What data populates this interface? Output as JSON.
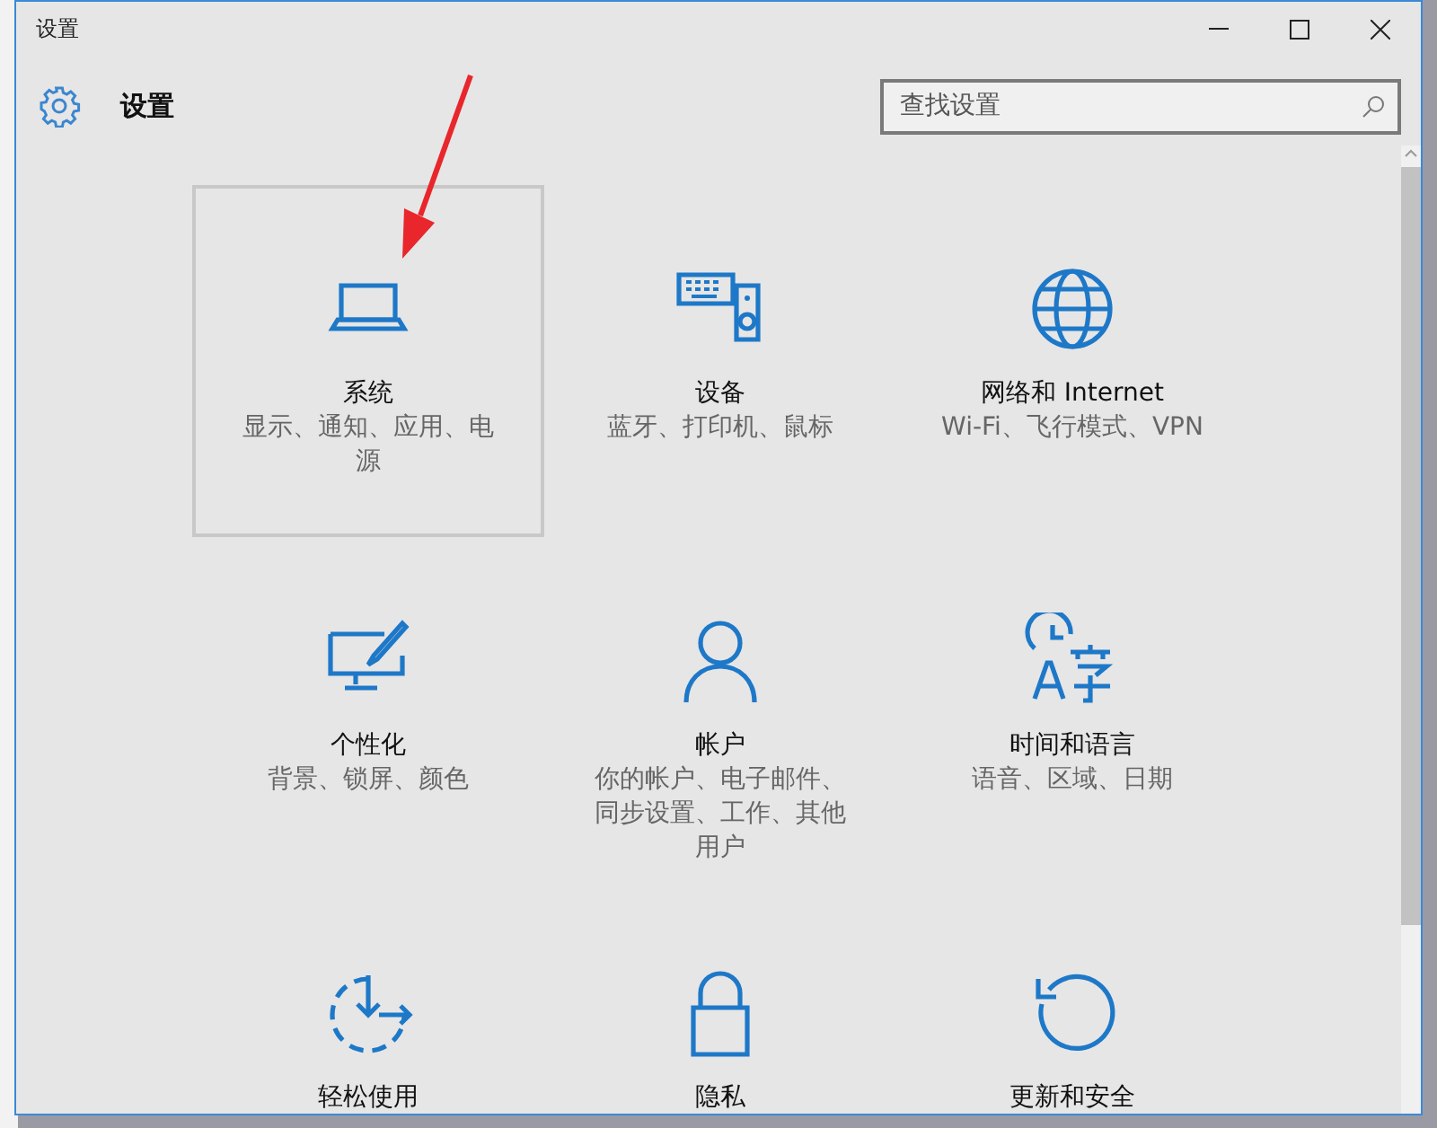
{
  "window": {
    "title": "设置"
  },
  "header": {
    "title": "设置"
  },
  "search": {
    "placeholder": "查找设置"
  },
  "tiles": [
    {
      "title": "系统",
      "subtitle": "显示、通知、应用、电源",
      "selected": true
    },
    {
      "title": "设备",
      "subtitle": "蓝牙、打印机、鼠标",
      "selected": false
    },
    {
      "title": "网络和 Internet",
      "subtitle": "Wi-Fi、飞行模式、VPN",
      "selected": false
    },
    {
      "title": "个性化",
      "subtitle": "背景、锁屏、颜色",
      "selected": false
    },
    {
      "title": "帐户",
      "subtitle": "你的帐户、电子邮件、同步设置、工作、其他用户",
      "selected": false
    },
    {
      "title": "时间和语言",
      "subtitle": "语音、区域、日期",
      "selected": false
    },
    {
      "title": "轻松使用",
      "selected": false
    },
    {
      "title": "隐私",
      "selected": false
    },
    {
      "title": "更新和安全",
      "selected": false
    }
  ]
}
